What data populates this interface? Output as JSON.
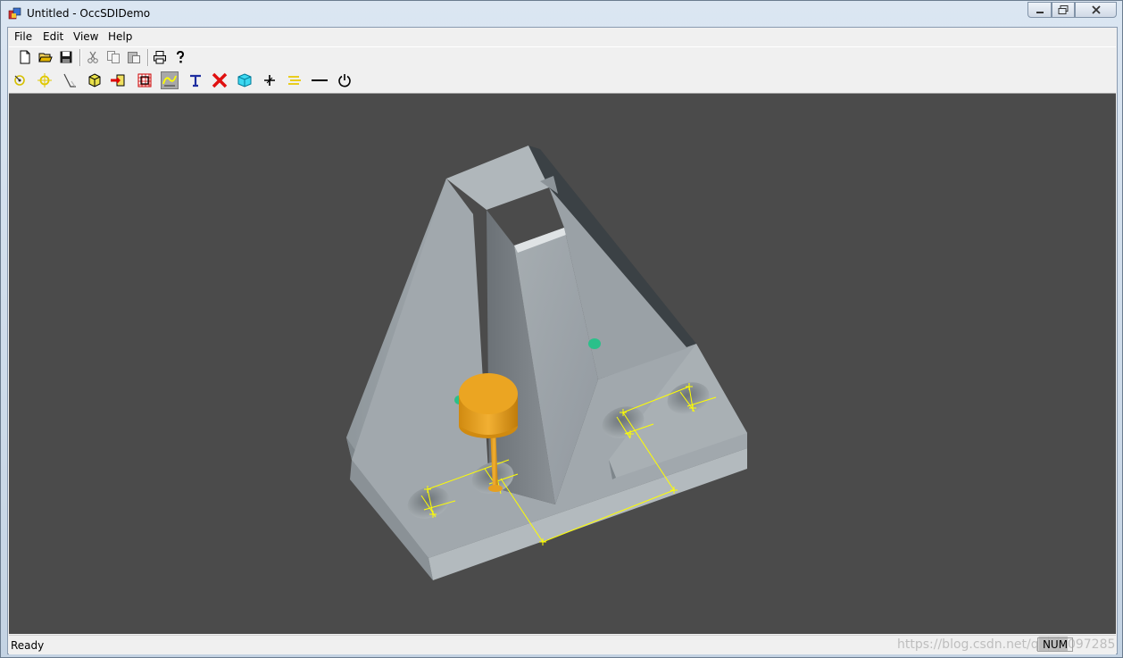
{
  "window": {
    "title": "Untitled - OccSDIDemo"
  },
  "menu": {
    "items": [
      "File",
      "Edit",
      "View",
      "Help"
    ]
  },
  "toolbar_file": {
    "icons": [
      "new-file-icon",
      "open-folder-icon",
      "save-icon",
      "cut-icon",
      "copy-icon",
      "paste-icon",
      "print-icon",
      "help-icon"
    ]
  },
  "toolbar_tools": {
    "icons": [
      "rotate-icon",
      "pan-icon",
      "select-edge-icon",
      "box-icon",
      "import-icon",
      "mesh-icon",
      "path-icon",
      "text-icon",
      "delete-icon",
      "cube-icon",
      "axis-icon",
      "lines-icon",
      "line-icon",
      "power-icon"
    ]
  },
  "status": {
    "ready": "Ready",
    "num": "NUM",
    "watermark": "https://blog.csdn.net/q███097285"
  },
  "colors": {
    "viewport_bg": "#4b4b4b",
    "part_gray": "#9aa1a6",
    "tool_orange": "#e8a21c",
    "dimension_yellow": "#ffff00",
    "marker_green": "#2bc08a"
  }
}
